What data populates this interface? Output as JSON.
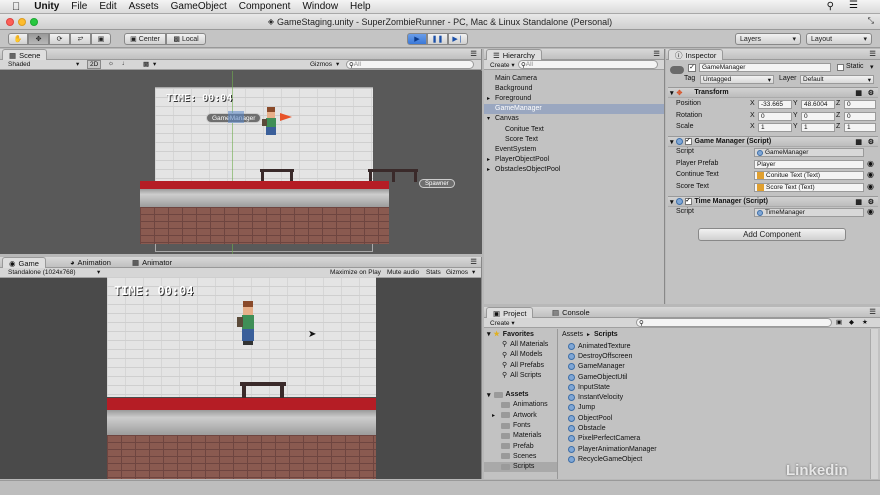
{
  "menubar": {
    "apple": "",
    "items": [
      "Unity",
      "File",
      "Edit",
      "Assets",
      "GameObject",
      "Component",
      "Window",
      "Help"
    ]
  },
  "titlebar": {
    "title": "GameStaging.unity - SuperZombieRunner - PC, Mac & Linux Standalone (Personal)"
  },
  "toolbar": {
    "pivot": "Center",
    "space": "Local",
    "layers": "Layers",
    "layout": "Layout"
  },
  "scene": {
    "tab": "Scene",
    "shading": "Shaded",
    "mode2d": "2D",
    "gizmos": "Gizmos",
    "search_placeholder": "All",
    "timer": "TIME: 00:04",
    "label_gamemanager": "GameManager",
    "label_spawner": "Spawner"
  },
  "game": {
    "tabs": [
      "Game",
      "Animation",
      "Animator"
    ],
    "resolution": "Standalone (1024x768)",
    "maximize": "Maximize on Play",
    "mute": "Mute audio",
    "stats": "Stats",
    "gizmos": "Gizmos",
    "timer": "TIME: 00:04"
  },
  "hierarchy": {
    "tab": "Hierarchy",
    "create": "Create",
    "search_placeholder": "All",
    "items": [
      {
        "label": "Main Camera",
        "indent": 0,
        "arrow": false
      },
      {
        "label": "Background",
        "indent": 0,
        "arrow": false
      },
      {
        "label": "Foreground",
        "indent": 0,
        "arrow": true
      },
      {
        "label": "GameManager",
        "indent": 0,
        "arrow": false,
        "selected": true
      },
      {
        "label": "Canvas",
        "indent": 0,
        "arrow": true,
        "open": true
      },
      {
        "label": "Conitue Text",
        "indent": 1,
        "arrow": false
      },
      {
        "label": "Score Text",
        "indent": 1,
        "arrow": false
      },
      {
        "label": "EventSystem",
        "indent": 0,
        "arrow": false
      },
      {
        "label": "PlayerObjectPool",
        "indent": 0,
        "arrow": true
      },
      {
        "label": "ObstaclesObjectPool",
        "indent": 0,
        "arrow": true
      }
    ]
  },
  "inspector": {
    "tab": "Inspector",
    "object_name": "GameManager",
    "static_label": "Static",
    "tag_label": "Tag",
    "tag_value": "Untagged",
    "layer_label": "Layer",
    "layer_value": "Default",
    "transform": {
      "title": "Transform",
      "position_label": "Position",
      "rotation_label": "Rotation",
      "scale_label": "Scale",
      "position": {
        "x": "-33.665",
        "y": "48.6004",
        "z": "0"
      },
      "rotation": {
        "x": "0",
        "y": "0",
        "z": "0"
      },
      "scale": {
        "x": "1",
        "y": "1",
        "z": "1"
      }
    },
    "game_manager": {
      "title": "Game Manager (Script)",
      "script_label": "Script",
      "script_value": "GameManager",
      "player_prefab_label": "Player Prefab",
      "player_prefab_value": "Player",
      "continue_label": "Continue Text",
      "continue_value": "Conitue Text (Text)",
      "score_label": "Score Text",
      "score_value": "Score Text (Text)"
    },
    "time_manager": {
      "title": "Time Manager (Script)",
      "script_label": "Script",
      "script_value": "TimeManager"
    },
    "add_component": "Add Component"
  },
  "project": {
    "tabs": [
      "Project",
      "Console"
    ],
    "create": "Create",
    "favorites_label": "Favorites",
    "favorites": [
      "All Materials",
      "All Models",
      "All Prefabs",
      "All Scripts"
    ],
    "assets_label": "Assets",
    "folders": [
      "Animations",
      "Artwork",
      "Fonts",
      "Materials",
      "Prefab",
      "Scenes",
      "Scripts"
    ],
    "breadcrumb_root": "Assets",
    "breadcrumb_sep": "►",
    "breadcrumb_current": "Scripts",
    "scripts": [
      "AnimatedTexture",
      "DestroyOffscreen",
      "GameManager",
      "GameObjectUtil",
      "InputState",
      "InstantVelocity",
      "Jump",
      "ObjectPool",
      "Obstacle",
      "PixelPerfectCamera",
      "PlayerAnimationManager",
      "RecycleGameObject"
    ]
  },
  "watermark": "Linkedin"
}
